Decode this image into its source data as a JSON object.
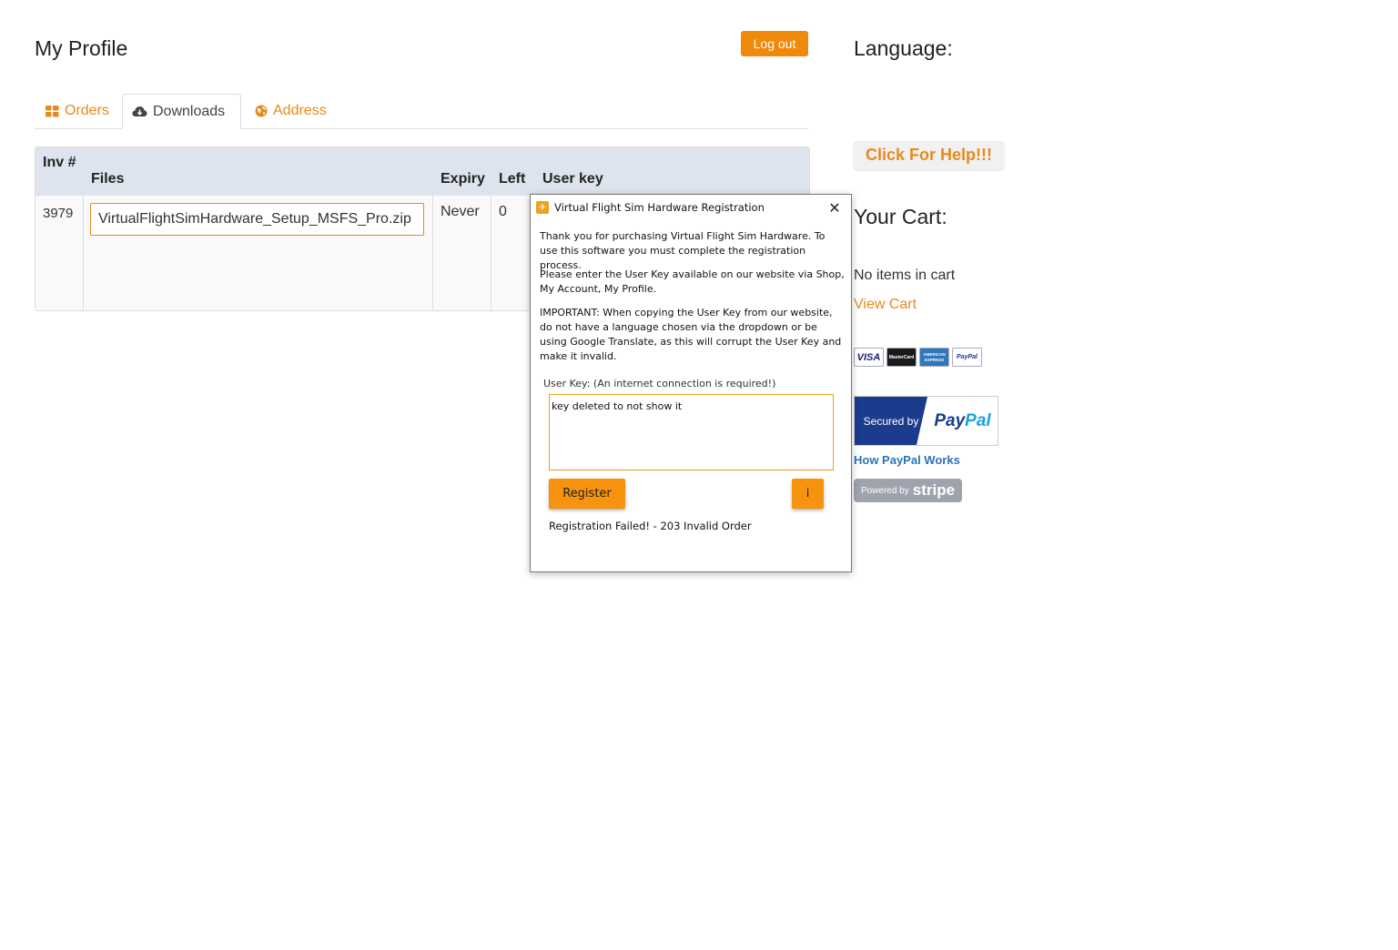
{
  "header": {
    "title": "My Profile",
    "logout_label": "Log out"
  },
  "tabs": [
    {
      "label": "Orders",
      "icon": "grid-icon",
      "active": false
    },
    {
      "label": "Downloads",
      "icon": "cloud-download-icon",
      "active": true
    },
    {
      "label": "Address",
      "icon": "globe-icon",
      "active": false
    }
  ],
  "downloads_table": {
    "headers": {
      "inv": "Inv #",
      "files": "Files",
      "expiry": "Expiry",
      "left": "Left",
      "user_key": "User key"
    },
    "rows": [
      {
        "inv": "3979",
        "file": "VirtualFlightSimHardware_Setup_MSFS_Pro.zip",
        "expiry": "Never",
        "left": "0"
      }
    ]
  },
  "sidebar": {
    "language_heading": "Language:",
    "help_button": "Click For Help!!!",
    "cart_heading": "Your Cart:",
    "cart_empty": "No items in cart",
    "view_cart": "View Cart",
    "cards": [
      "VISA",
      "MasterCard",
      "AMERICAN EXPRESS",
      "PayPal"
    ],
    "paypal_secured": "Secured by",
    "paypal_logo_a": "Pay",
    "paypal_logo_b": "Pal",
    "how_paypal": "How PayPal Works",
    "stripe_powered": "Powered by",
    "stripe_logo": "stripe"
  },
  "dialog": {
    "title": "Virtual Flight Sim Hardware Registration",
    "para1": "Thank you for purchasing Virtual Flight Sim Hardware. To use this software you must complete the registration process.",
    "para2": "Please enter the User Key available on our website via Shop, My Account, My Profile.",
    "para3": "IMPORTANT: When copying the User Key from our website, do not have a language chosen via the dropdown or be using Google Translate, as this will corrupt the User Key and make it invalid.",
    "key_label": "User Key:  (An internet connection is required!)",
    "key_value": "key deleted to not show it",
    "register_label": "Register",
    "info_label": "i",
    "status": "Registration Failed! - 203 Invalid Order"
  },
  "colors": {
    "accent": "#f0880a",
    "link": "#e8891b",
    "paypal_blue": "#1b3b8c",
    "table_header": "#dde4ee"
  }
}
